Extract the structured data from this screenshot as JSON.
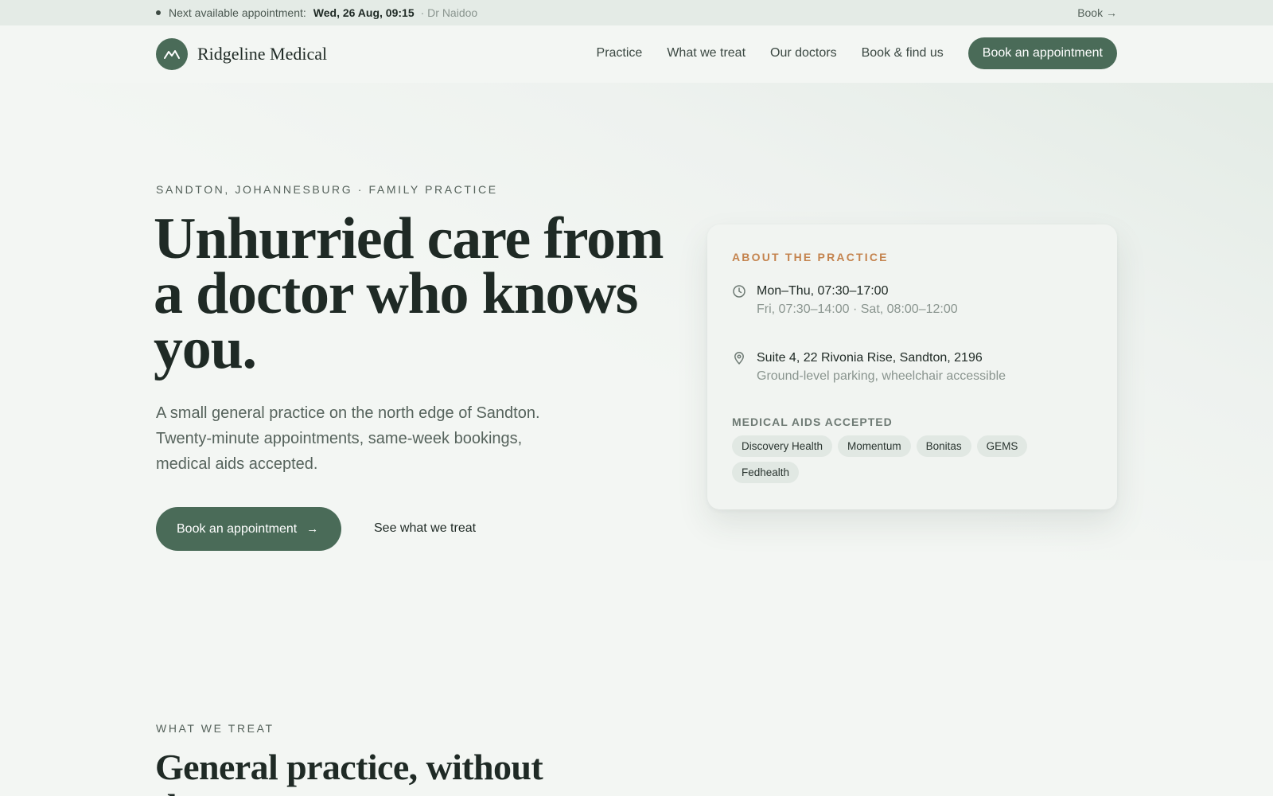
{
  "topbar": {
    "label": "Next available appointment:",
    "when": "Wed, 26 Aug, 09:15",
    "doctor": "· Dr Naidoo",
    "book_link": "Book →"
  },
  "nav": {
    "brand": "Ridgeline Medical",
    "links": [
      "Practice",
      "What we treat",
      "Our doctors",
      "Book & find us"
    ],
    "cta": "Book an appointment"
  },
  "hero": {
    "eyebrow": "SANDTON, JOHANNESBURG · FAMILY PRACTICE",
    "headline": "Unhurried care from a doctor who knows you.",
    "lede": "A small general practice on the north edge of Sandton. Twenty-minute appointments, same-week bookings, medical aids accepted.",
    "primary_cta": "Book an appointment",
    "secondary_cta": "See what we treat"
  },
  "card": {
    "title": "ABOUT THE PRACTICE",
    "hours": {
      "icon": "clock-icon",
      "primary": "Mon–Thu, 07:30–17:00",
      "secondary": "Fri, 07:30–14:00 · Sat, 08:00–12:00"
    },
    "address": {
      "icon": "location-pin-icon",
      "primary": "Suite 4, 22 Rivonia Rise, Sandton, 2196",
      "secondary": "Ground-level parking, wheelchair accessible"
    },
    "aids_title": "MEDICAL AIDS ACCEPTED",
    "aids": [
      "Discovery Health",
      "Momentum",
      "Bonitas",
      "GEMS",
      "Fedhealth"
    ]
  },
  "section": {
    "eyebrow": "WHAT WE TREAT",
    "title": "General practice, without the"
  },
  "colors": {
    "accent": "#4a6b58",
    "highlight": "#c4834e",
    "background": "#f3f6f3"
  }
}
